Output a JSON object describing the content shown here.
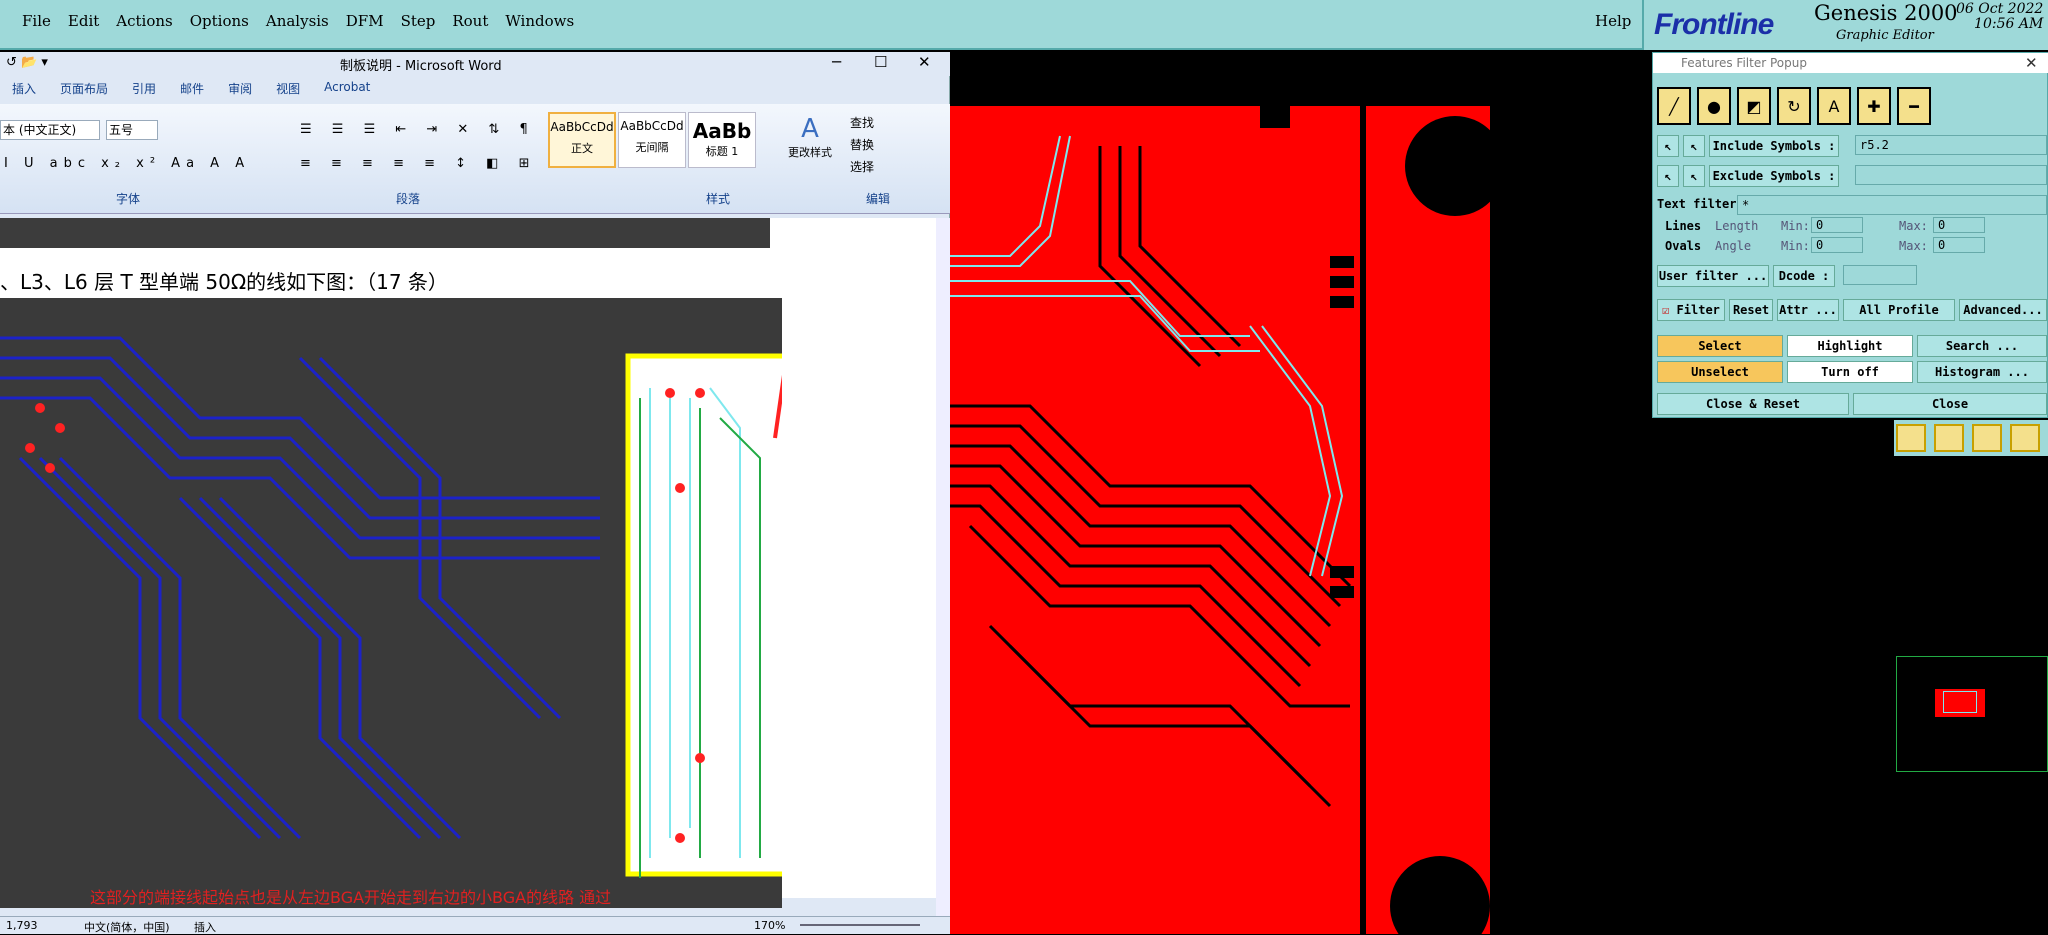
{
  "genesis": {
    "menus": [
      "File",
      "Edit",
      "Actions",
      "Options",
      "Analysis",
      "DFM",
      "Step",
      "Rout",
      "Windows"
    ],
    "help": "Help",
    "brand": "Frontline",
    "product": "Genesis 2000",
    "subtitle": "Graphic Editor",
    "date": "06 Oct 2022",
    "time": "10:56 AM"
  },
  "word": {
    "title": "制板说明 - Microsoft Word",
    "tabs": [
      "插入",
      "页面布局",
      "引用",
      "邮件",
      "审阅",
      "视图",
      "Acrobat"
    ],
    "font_name": "本 (中文正文)",
    "font_size": "五号",
    "groups": {
      "font": "字体",
      "paragraph": "段落",
      "styles": "样式",
      "edit": "编辑"
    },
    "styles": [
      {
        "sample": "AaBbCcDd",
        "name": "正文"
      },
      {
        "sample": "AaBbCcDd",
        "name": "无间隔"
      },
      {
        "sample": "AaBb",
        "name": "标题 1"
      }
    ],
    "change_styles": "更改样式",
    "edit_items": [
      "查找",
      "替换",
      "选择"
    ],
    "doc_line": "、L3、L6 层 T 型单端 50Ω的线如下图：（17 条）",
    "bottom_line": "这部分的端接线起始点也是从左边BGA开始走到右边的小BGA的线路 通过",
    "status": {
      "page": "1,793",
      "lang": "中文(简体，中国)",
      "mode": "插入",
      "zoom": "170%"
    }
  },
  "popup": {
    "title": "Features Filter Popup",
    "include_label": "Include Symbols :",
    "include_value": "r5.2",
    "exclude_label": "Exclude Symbols :",
    "exclude_value": "",
    "text_filter_label": "Text filter",
    "text_filter_value": "*",
    "lines": "Lines",
    "ovals": "Ovals",
    "length": "Length",
    "angle": "Angle",
    "min": "Min:",
    "max": "Max:",
    "min_len": "0",
    "max_len": "0",
    "min_ang": "0",
    "max_ang": "0",
    "user_filter": "User filter ...",
    "dcode": "Dcode :",
    "filter": "Filter",
    "reset": "Reset",
    "attr": "Attr ...",
    "all_profile": "All Profile",
    "advanced": "Advanced...",
    "select": "Select",
    "highlight": "Highlight",
    "search": "Search ...",
    "unselect": "Unselect",
    "turn_off": "Turn off",
    "histogram": "Histogram ...",
    "close_reset": "Close & Reset",
    "close": "Close"
  },
  "colors": {
    "genesis_bg": "#9ed9d9",
    "board": "#ff0000",
    "trace_cyan": "#7fe8ee",
    "word_ribbon": "#dfe8f5"
  }
}
